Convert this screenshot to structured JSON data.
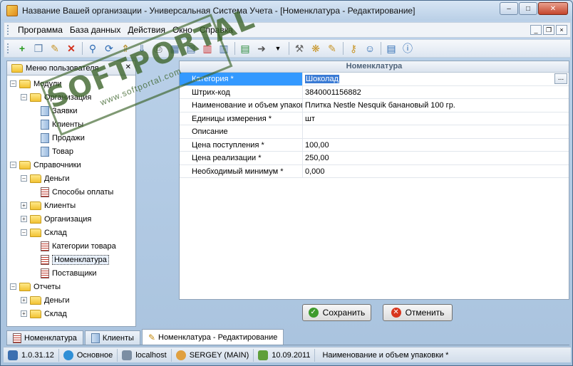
{
  "window": {
    "title": "Название Вашей организации - Универсальная Система Учета - [Номенклатура - Редактирование]"
  },
  "menu": {
    "items": [
      "Программа",
      "База данных",
      "Действия",
      "Окно",
      "Справка"
    ]
  },
  "toolbar": {
    "icons": [
      "add-icon",
      "copy-icon",
      "edit-icon",
      "delete-icon",
      "search-icon",
      "refresh-icon",
      "export-icon",
      "import-icon",
      "print-icon",
      "settings-icon",
      "key-icon",
      "users-icon",
      "book-icon",
      "info-icon"
    ]
  },
  "sidebar": {
    "title": "Меню пользователя",
    "tree": {
      "modules": "Модули",
      "org": "Организация",
      "orders": "Заявки",
      "clients": "Клиенты",
      "sales": "Продажи",
      "goods": "Товар",
      "refs": "Справочники",
      "money": "Деньги",
      "payment_methods": "Способы оплаты",
      "ref_clients": "Клиенты",
      "ref_org": "Организация",
      "warehouse": "Склад",
      "categories": "Категории товара",
      "nomenclature": "Номенклатура",
      "suppliers": "Поставщики",
      "reports": "Отчеты",
      "rep_money": "Деньги",
      "rep_warehouse": "Склад"
    }
  },
  "form": {
    "header": "Номенклатура",
    "rows": [
      {
        "label": "Категория *",
        "value": "Шоколад"
      },
      {
        "label": "Штрих-код",
        "value": "3840001156882"
      },
      {
        "label": "Наименование и объем упаковки *",
        "value": "Плитка Nestle Nesquik банановый 100 гр."
      },
      {
        "label": "Единицы измерения *",
        "value": "шт"
      },
      {
        "label": "Описание",
        "value": ""
      },
      {
        "label": "Цена поступления *",
        "value": "100,00"
      },
      {
        "label": "Цена реализации *",
        "value": "250,00"
      },
      {
        "label": "Необходимый минимум *",
        "value": "0,000"
      }
    ],
    "ellipsis": "...",
    "save_label": "Сохранить",
    "cancel_label": "Отменить"
  },
  "tabs": [
    "Номенклатура",
    "Клиенты",
    "Номенклатура - Редактирование"
  ],
  "status": {
    "version": "1.0.31.12",
    "mode": "Основное",
    "host": "localhost",
    "user": "SERGEY (MAIN)",
    "date": "10.09.2011",
    "hint": "Наименование и объем упаковки *"
  },
  "watermark": {
    "main": "SOFTPORTAL",
    "sub": "www.softportal.com"
  }
}
